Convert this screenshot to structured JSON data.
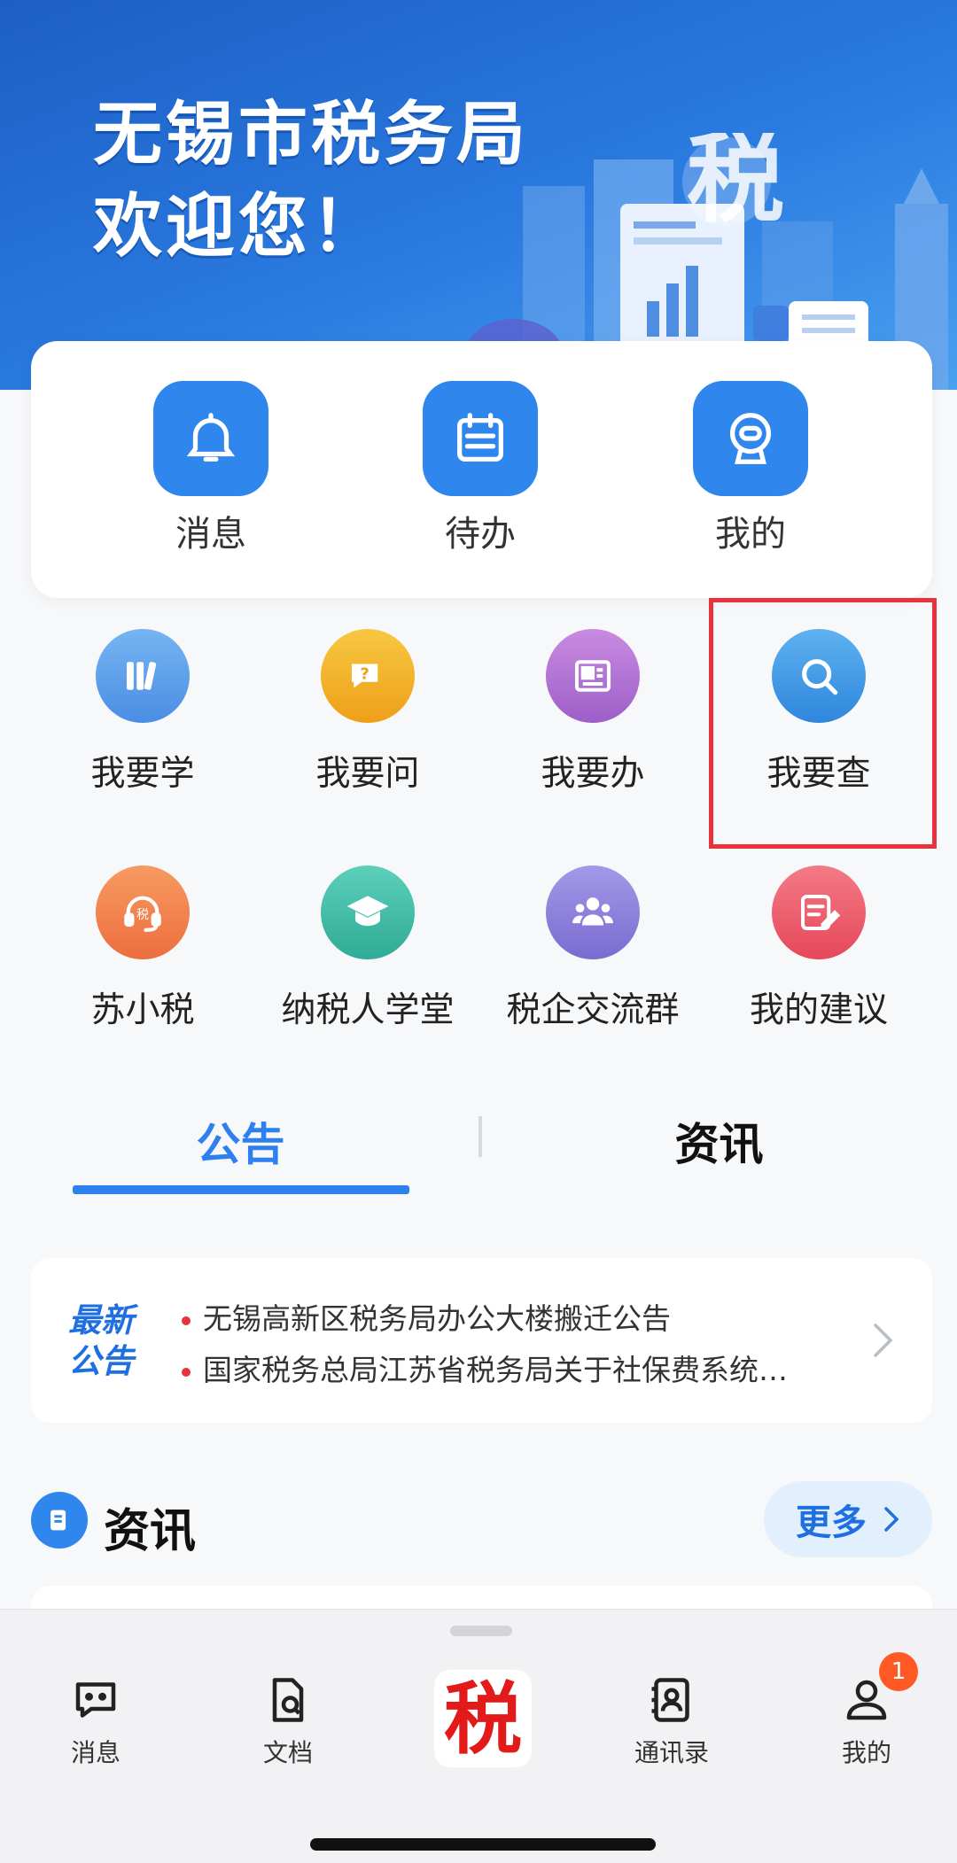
{
  "banner": {
    "line1": "无锡市税务局",
    "line2": "欢迎您！"
  },
  "shortcuts": [
    {
      "label": "消息",
      "icon": "bell-icon"
    },
    {
      "label": "待办",
      "icon": "calendar-icon"
    },
    {
      "label": "我的",
      "icon": "robot-icon"
    }
  ],
  "grid": [
    {
      "label": "我要学",
      "icon": "books-icon",
      "color": "#5aa0ec"
    },
    {
      "label": "我要问",
      "icon": "question-chat-icon",
      "color": "#f2b320"
    },
    {
      "label": "我要办",
      "icon": "newspaper-icon",
      "color": "#b06ed0"
    },
    {
      "label": "我要查",
      "icon": "search-icon",
      "color": "#3a95e6"
    },
    {
      "label": "苏小税",
      "icon": "headset-icon",
      "color": "#f28050"
    },
    {
      "label": "纳税人学堂",
      "icon": "graduation-cap-icon",
      "color": "#3fbfa8"
    },
    {
      "label": "税企交流群",
      "icon": "group-icon",
      "color": "#8a7fd8"
    },
    {
      "label": "我的建议",
      "icon": "edit-note-icon",
      "color": "#ee5a6a"
    }
  ],
  "tabs": {
    "active": "公告",
    "other": "资讯"
  },
  "notice": {
    "badge_line1": "最新",
    "badge_line2": "公告",
    "items": [
      "无锡高新区税务局办公大楼搬迁公告",
      "国家税务总局江苏省税务局关于社保费系统…"
    ]
  },
  "news": {
    "title": "资讯",
    "more": "更多"
  },
  "bottom_nav": {
    "items": [
      {
        "label": "消息",
        "icon": "chat-icon"
      },
      {
        "label": "文档",
        "icon": "document-icon"
      },
      {
        "label": "通讯录",
        "icon": "contacts-icon"
      },
      {
        "label": "我的",
        "icon": "person-icon"
      }
    ],
    "center_glyph": "税",
    "badge_count": "1"
  }
}
